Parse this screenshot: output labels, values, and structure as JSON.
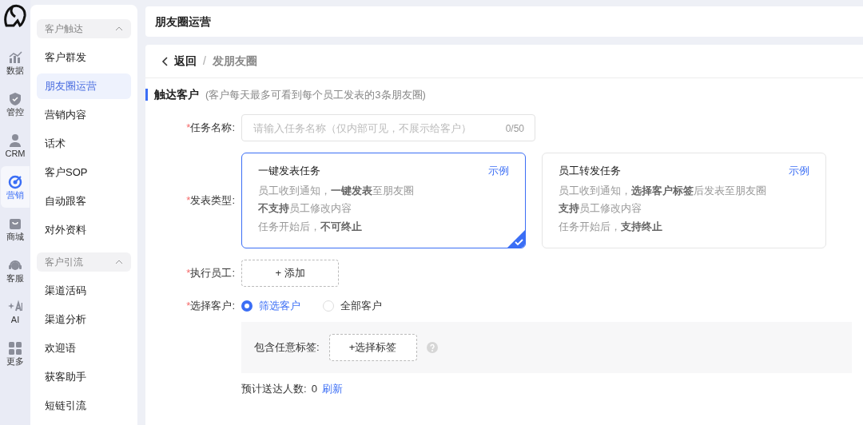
{
  "nav_rail": [
    {
      "label": "数据",
      "selected": false
    },
    {
      "label": "管控",
      "selected": false
    },
    {
      "label": "CRM",
      "selected": false
    },
    {
      "label": "营销",
      "selected": true
    },
    {
      "label": "商城",
      "selected": false
    },
    {
      "label": "客服",
      "selected": false
    },
    {
      "label": "AI",
      "selected": false
    },
    {
      "label": "更多",
      "selected": false
    }
  ],
  "sidebar": {
    "groups": [
      {
        "title": "客户触达",
        "expanded": true,
        "items": [
          {
            "label": "客户群发",
            "selected": false
          },
          {
            "label": "朋友圈运营",
            "selected": true
          },
          {
            "label": "营销内容",
            "selected": false
          },
          {
            "label": "话术",
            "selected": false
          },
          {
            "label": "客户SOP",
            "selected": false
          },
          {
            "label": "自动跟客",
            "selected": false
          },
          {
            "label": "对外资料",
            "selected": false
          }
        ]
      },
      {
        "title": "客户引流",
        "expanded": true,
        "items": [
          {
            "label": "渠道活码",
            "selected": false
          },
          {
            "label": "渠道分析",
            "selected": false
          },
          {
            "label": "欢迎语",
            "selected": false
          },
          {
            "label": "获客助手",
            "selected": false
          },
          {
            "label": "短链引流",
            "selected": false
          }
        ]
      }
    ]
  },
  "page_title": "朋友圈运营",
  "breadcrumb": {
    "back": "返回",
    "separator": "/",
    "current": "发朋友圈"
  },
  "section": {
    "title": "触达客户",
    "note": "(客户每天最多可看到每个员工发表的3条朋友圈)"
  },
  "form": {
    "task_name": {
      "label": "任务名称:",
      "required_mark": "*",
      "placeholder": "请输入任务名称（仅内部可见，不展示给客户）",
      "counter": "0/50"
    },
    "publish_type": {
      "label": "发表类型:",
      "required_mark": "*",
      "options": [
        {
          "title": "一键发表任务",
          "link": "示例",
          "selected": true,
          "lines": [
            "员工收到通知，**一键发表**至朋友圈",
            "**不支持**员工修改内容",
            "任务开始后，**不可终止**"
          ]
        },
        {
          "title": "员工转发任务",
          "link": "示例",
          "selected": false,
          "lines": [
            "员工收到通知，**选择客户标签**后发表至朋友圈",
            "**支持**员工修改内容",
            "任务开始后，**支持终止**"
          ]
        }
      ]
    },
    "staff": {
      "label": "执行员工:",
      "required_mark": "*",
      "button": "+ 添加"
    },
    "customers": {
      "label": "选择客户:",
      "required_mark": "*",
      "options": [
        {
          "label": "筛选客户",
          "selected": true
        },
        {
          "label": "全部客户",
          "selected": false
        }
      ],
      "tag_filter": {
        "label": "包含任意标签:",
        "button": "+选择标签"
      }
    },
    "estimate": {
      "label": "预计送达人数:",
      "value": "0",
      "link": "刷新"
    }
  }
}
